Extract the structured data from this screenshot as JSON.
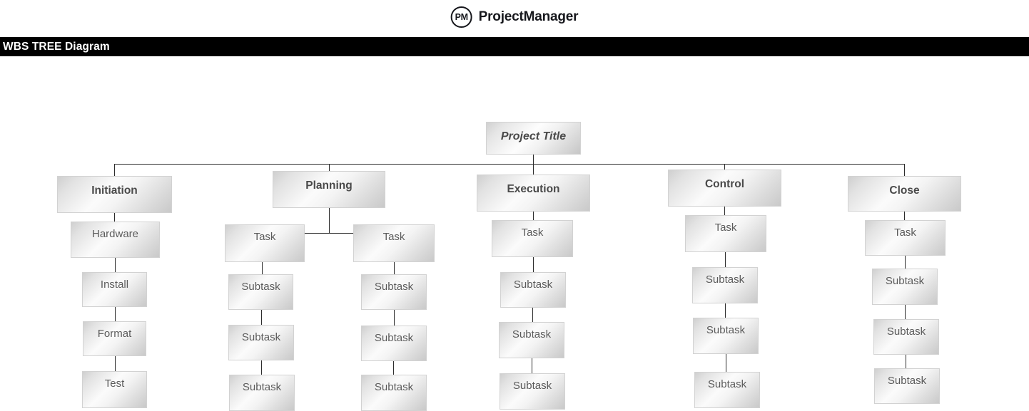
{
  "brand": {
    "mark_text": "PM",
    "name": "ProjectManager",
    "mark_icon": "pm-circle-logo"
  },
  "title_band": {
    "text": "WBS TREE Diagram"
  },
  "colors": {
    "band_background": "#000000",
    "band_text": "#ffffff",
    "node_text": "#5b5b5b",
    "node_border": "#d2d2d2",
    "connector": "#2d2d2d"
  },
  "diagram": {
    "type": "wbs-tree",
    "root": {
      "label": "Project Title"
    },
    "branches": [
      {
        "label": "Initiation",
        "children": [
          {
            "label": "Hardware"
          },
          {
            "label": "Install"
          },
          {
            "label": "Format"
          },
          {
            "label": "Test"
          }
        ]
      },
      {
        "label": "Planning",
        "children": [
          {
            "label": "Task"
          },
          {
            "label": "Task"
          },
          {
            "label": "Subtask"
          },
          {
            "label": "Subtask"
          },
          {
            "label": "Subtask"
          },
          {
            "label": "Subtask"
          },
          {
            "label": "Subtask"
          },
          {
            "label": "Subtask"
          }
        ]
      },
      {
        "label": "Execution",
        "children": [
          {
            "label": "Task"
          },
          {
            "label": "Subtask"
          },
          {
            "label": "Subtask"
          },
          {
            "label": "Subtask"
          }
        ]
      },
      {
        "label": "Control",
        "children": [
          {
            "label": "Task"
          },
          {
            "label": "Subtask"
          },
          {
            "label": "Subtask"
          },
          {
            "label": "Subtask"
          }
        ]
      },
      {
        "label": "Close",
        "children": [
          {
            "label": "Task"
          },
          {
            "label": "Subtask"
          },
          {
            "label": "Subtask"
          },
          {
            "label": "Subtask"
          }
        ]
      }
    ]
  }
}
